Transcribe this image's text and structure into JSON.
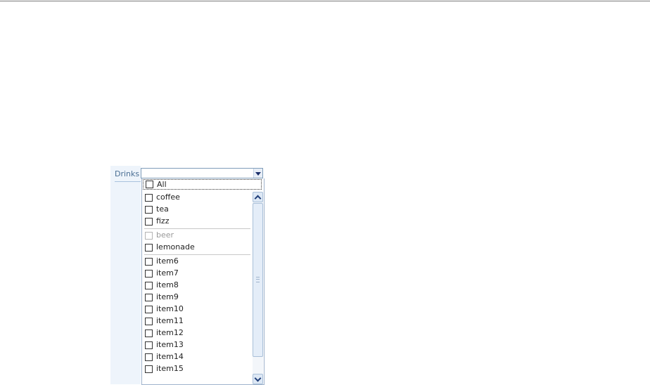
{
  "field": {
    "label": "Drinks",
    "value": ""
  },
  "dropdown": {
    "all_label": "All",
    "groups": [
      {
        "items": [
          {
            "label": "coffee",
            "disabled": false
          },
          {
            "label": "tea",
            "disabled": false
          },
          {
            "label": "fizz",
            "disabled": false
          }
        ]
      },
      {
        "items": [
          {
            "label": "beer",
            "disabled": true
          },
          {
            "label": "lemonade",
            "disabled": false
          }
        ]
      },
      {
        "items": [
          {
            "label": "item6",
            "disabled": false
          },
          {
            "label": "item7",
            "disabled": false
          },
          {
            "label": "item8",
            "disabled": false
          },
          {
            "label": "item9",
            "disabled": false
          },
          {
            "label": "item10",
            "disabled": false
          },
          {
            "label": "item11",
            "disabled": false
          },
          {
            "label": "item12",
            "disabled": false
          },
          {
            "label": "item13",
            "disabled": false
          },
          {
            "label": "item14",
            "disabled": false
          },
          {
            "label": "item15",
            "disabled": false
          }
        ]
      }
    ]
  },
  "icons": {
    "dropdown_toggle": "chevron-down-icon",
    "scroll_up": "chevron-up-icon",
    "scroll_down": "chevron-down-icon"
  },
  "colors": {
    "label_text": "#4a6e93",
    "label_column_bg": "#eef4fb",
    "disabled_text": "#9a9a9a"
  }
}
